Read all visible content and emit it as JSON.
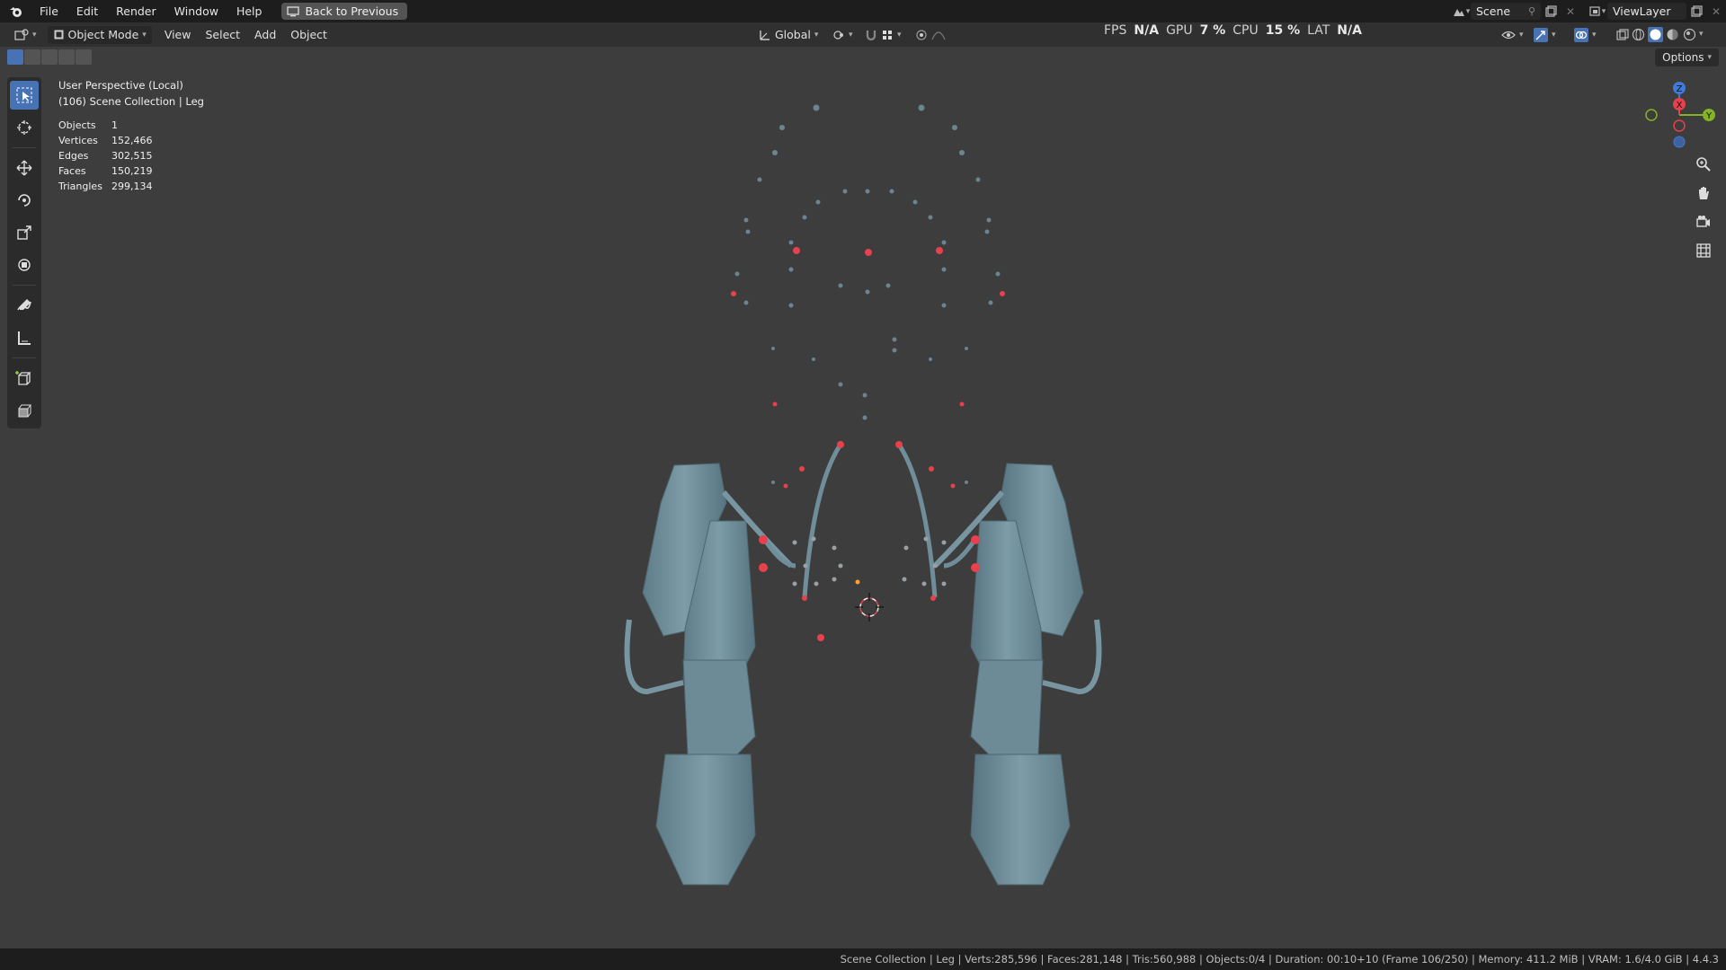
{
  "topbar": {
    "menu": [
      "File",
      "Edit",
      "Render",
      "Window",
      "Help"
    ],
    "back_label": "Back to Previous",
    "scene_name": "Scene",
    "view_layer": "ViewLayer"
  },
  "header": {
    "mode": "Object Mode",
    "menus": [
      "View",
      "Select",
      "Add",
      "Object"
    ],
    "transform_orientation": "Global",
    "options_label": "Options"
  },
  "perf": {
    "fps_label": "FPS",
    "fps": "N/A",
    "gpu_label": "GPU",
    "gpu": "7 %",
    "cpu_label": "CPU",
    "cpu": "15 %",
    "lat_label": "LAT",
    "lat": "N/A"
  },
  "viewport": {
    "perspective": "User Perspective (Local)",
    "collection": "(106) Scene Collection | Leg",
    "stats": [
      {
        "label": "Objects",
        "value": "1"
      },
      {
        "label": "Vertices",
        "value": "152,466"
      },
      {
        "label": "Edges",
        "value": "302,515"
      },
      {
        "label": "Faces",
        "value": "150,219"
      },
      {
        "label": "Triangles",
        "value": "299,134"
      }
    ]
  },
  "gizmo": {
    "x": "X",
    "y": "Y",
    "z": "Z"
  },
  "statusbar": {
    "text": "Scene Collection | Leg | Verts:285,596 | Faces:281,148 | Tris:560,988 | Objects:0/4 | Duration: 00:10+10 (Frame 106/250) | Memory: 411.2 MiB | VRAM: 1.6/4.0 GiB | 4.4.3"
  },
  "colors": {
    "accent": "#4772b3",
    "mesh": "#6f8e9a",
    "empty_red": "#e8404c",
    "axis_x": "#e8404c",
    "axis_y": "#84b326",
    "axis_z": "#3e7bdc"
  },
  "icons": [
    "blender-logo",
    "select-box-icon",
    "cursor-icon",
    "move-icon",
    "rotate-icon",
    "scale-icon",
    "transform-icon",
    "annotate-icon",
    "measure-icon",
    "add-cube-icon",
    "extrude-icon",
    "zoom-icon",
    "hand-icon",
    "camera-icon",
    "grid-icon"
  ]
}
